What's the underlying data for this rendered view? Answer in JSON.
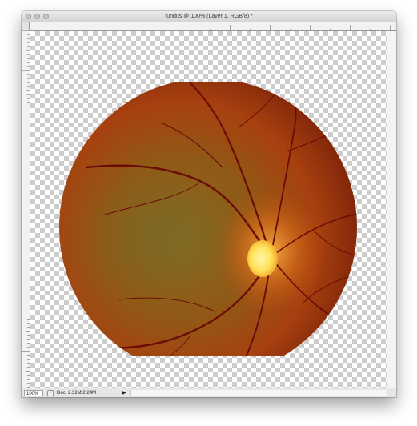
{
  "window": {
    "title": "fundus @ 100% (Layer 1, RGB/8) *",
    "controls": {
      "close": "close-button",
      "minimize": "minimize-button",
      "zoom": "zoom-button"
    }
  },
  "status_bar": {
    "zoom": "100%",
    "doc_info": "Doc: 2.32M/2.24M",
    "menu_arrow": "▶"
  },
  "canvas": {
    "layer": "Layer 1",
    "background": "transparency-checkerboard",
    "image": "retinal-fundus-photograph"
  },
  "colors": {
    "fundus_outer": "#5a120a",
    "fundus_mid": "#a8400f",
    "fundus_macula": "#8a6a1e",
    "optic_disc": "#ffe25a",
    "vessel": "#6a0d08"
  }
}
